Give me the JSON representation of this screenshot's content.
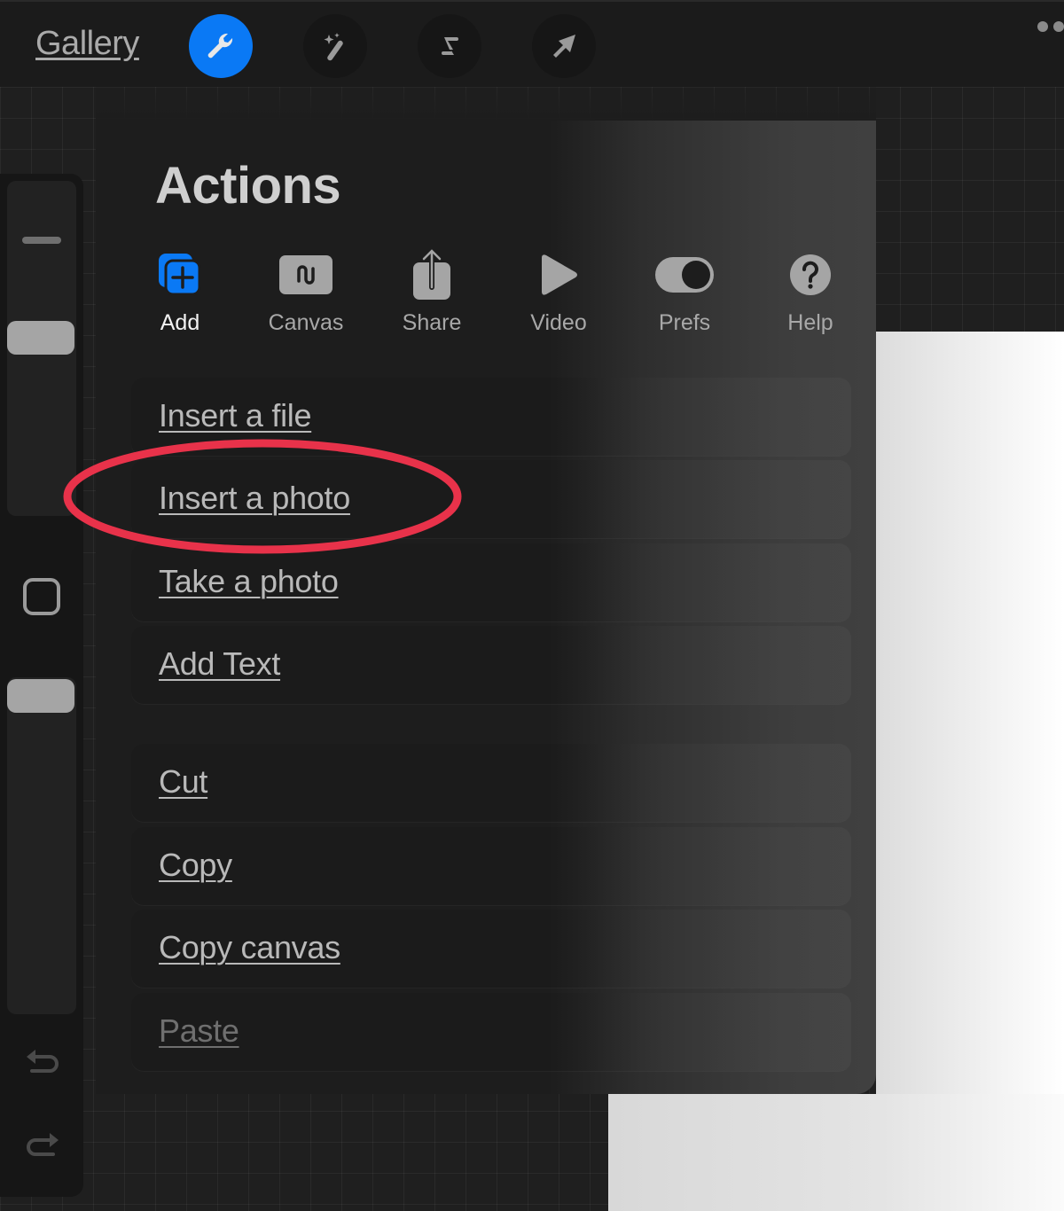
{
  "topbar": {
    "gallery_label": "Gallery",
    "tools": [
      {
        "name": "actions",
        "icon": "wrench-icon",
        "active": true
      },
      {
        "name": "adjustments",
        "icon": "magic-wand-icon",
        "active": false
      },
      {
        "name": "selection",
        "icon": "selection-s-icon",
        "active": false
      },
      {
        "name": "transform",
        "icon": "arrow-cursor-icon",
        "active": false
      }
    ],
    "more_icon": "more-dots-icon"
  },
  "sidebar": {
    "brush_size_icon": "dash-icon",
    "modify_icon": "square-icon",
    "undo_icon": "undo-icon",
    "redo_icon": "redo-icon"
  },
  "panel": {
    "title": "Actions",
    "tabs": [
      {
        "label": "Add",
        "icon": "add-layers-icon",
        "active": true
      },
      {
        "label": "Canvas",
        "icon": "canvas-wave-icon",
        "active": false
      },
      {
        "label": "Share",
        "icon": "share-icon",
        "active": false
      },
      {
        "label": "Video",
        "icon": "play-icon",
        "active": false
      },
      {
        "label": "Prefs",
        "icon": "toggle-icon",
        "active": false
      },
      {
        "label": "Help",
        "icon": "question-icon",
        "active": false
      }
    ],
    "menu_group_1": [
      {
        "label": "Insert a file",
        "enabled": true
      },
      {
        "label": "Insert a photo",
        "enabled": true,
        "highlighted": true
      },
      {
        "label": "Take a photo",
        "enabled": true
      },
      {
        "label": "Add Text",
        "enabled": true
      }
    ],
    "menu_group_2": [
      {
        "label": "Cut",
        "enabled": true
      },
      {
        "label": "Copy",
        "enabled": true
      },
      {
        "label": "Copy canvas",
        "enabled": true
      },
      {
        "label": "Paste",
        "enabled": false
      }
    ]
  },
  "colors": {
    "accent": "#0a79f5",
    "highlight_annotation": "#e8324a",
    "icon_gray": "#a5a5a5"
  }
}
